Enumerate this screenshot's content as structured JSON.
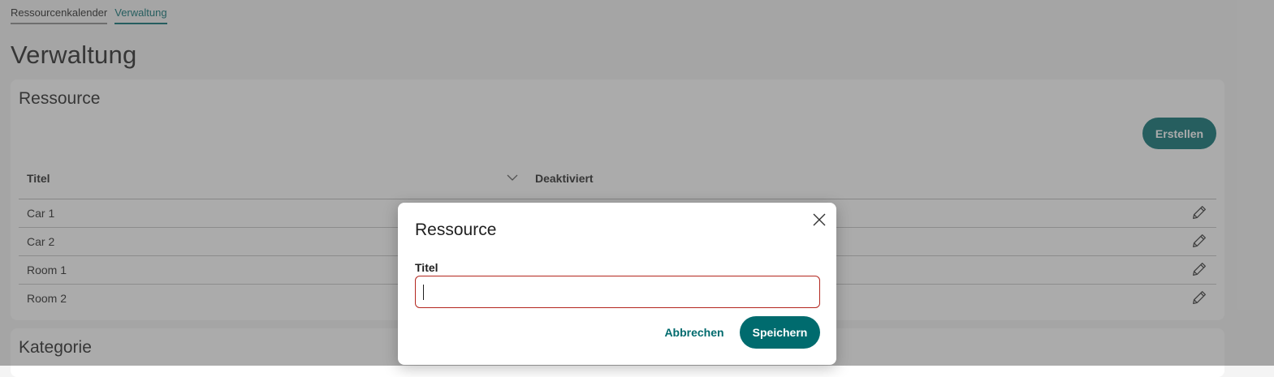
{
  "tabs": [
    {
      "label": "Ressourcenkalender",
      "active": false
    },
    {
      "label": "Verwaltung",
      "active": true
    }
  ],
  "page_title": "Verwaltung",
  "resource_card": {
    "title": "Ressource",
    "create_label": "Erstellen",
    "columns": {
      "title": "Titel",
      "deactivated": "Deaktiviert"
    },
    "sort_icon": "chevron-down-icon",
    "edit_icon": "pencil-icon",
    "rows": [
      {
        "title": "Car 1"
      },
      {
        "title": "Car 2"
      },
      {
        "title": "Room 1"
      },
      {
        "title": "Room 2"
      }
    ]
  },
  "category_card": {
    "title": "Kategorie"
  },
  "dialog": {
    "title": "Ressource",
    "field_label": "Titel",
    "field_value": "",
    "cancel_label": "Abbrechen",
    "save_label": "Speichern",
    "close_icon": "close-icon"
  },
  "colors": {
    "accent": "#006b6e",
    "error": "#b3261e",
    "overlay": "rgba(80,80,80,0.48)"
  }
}
